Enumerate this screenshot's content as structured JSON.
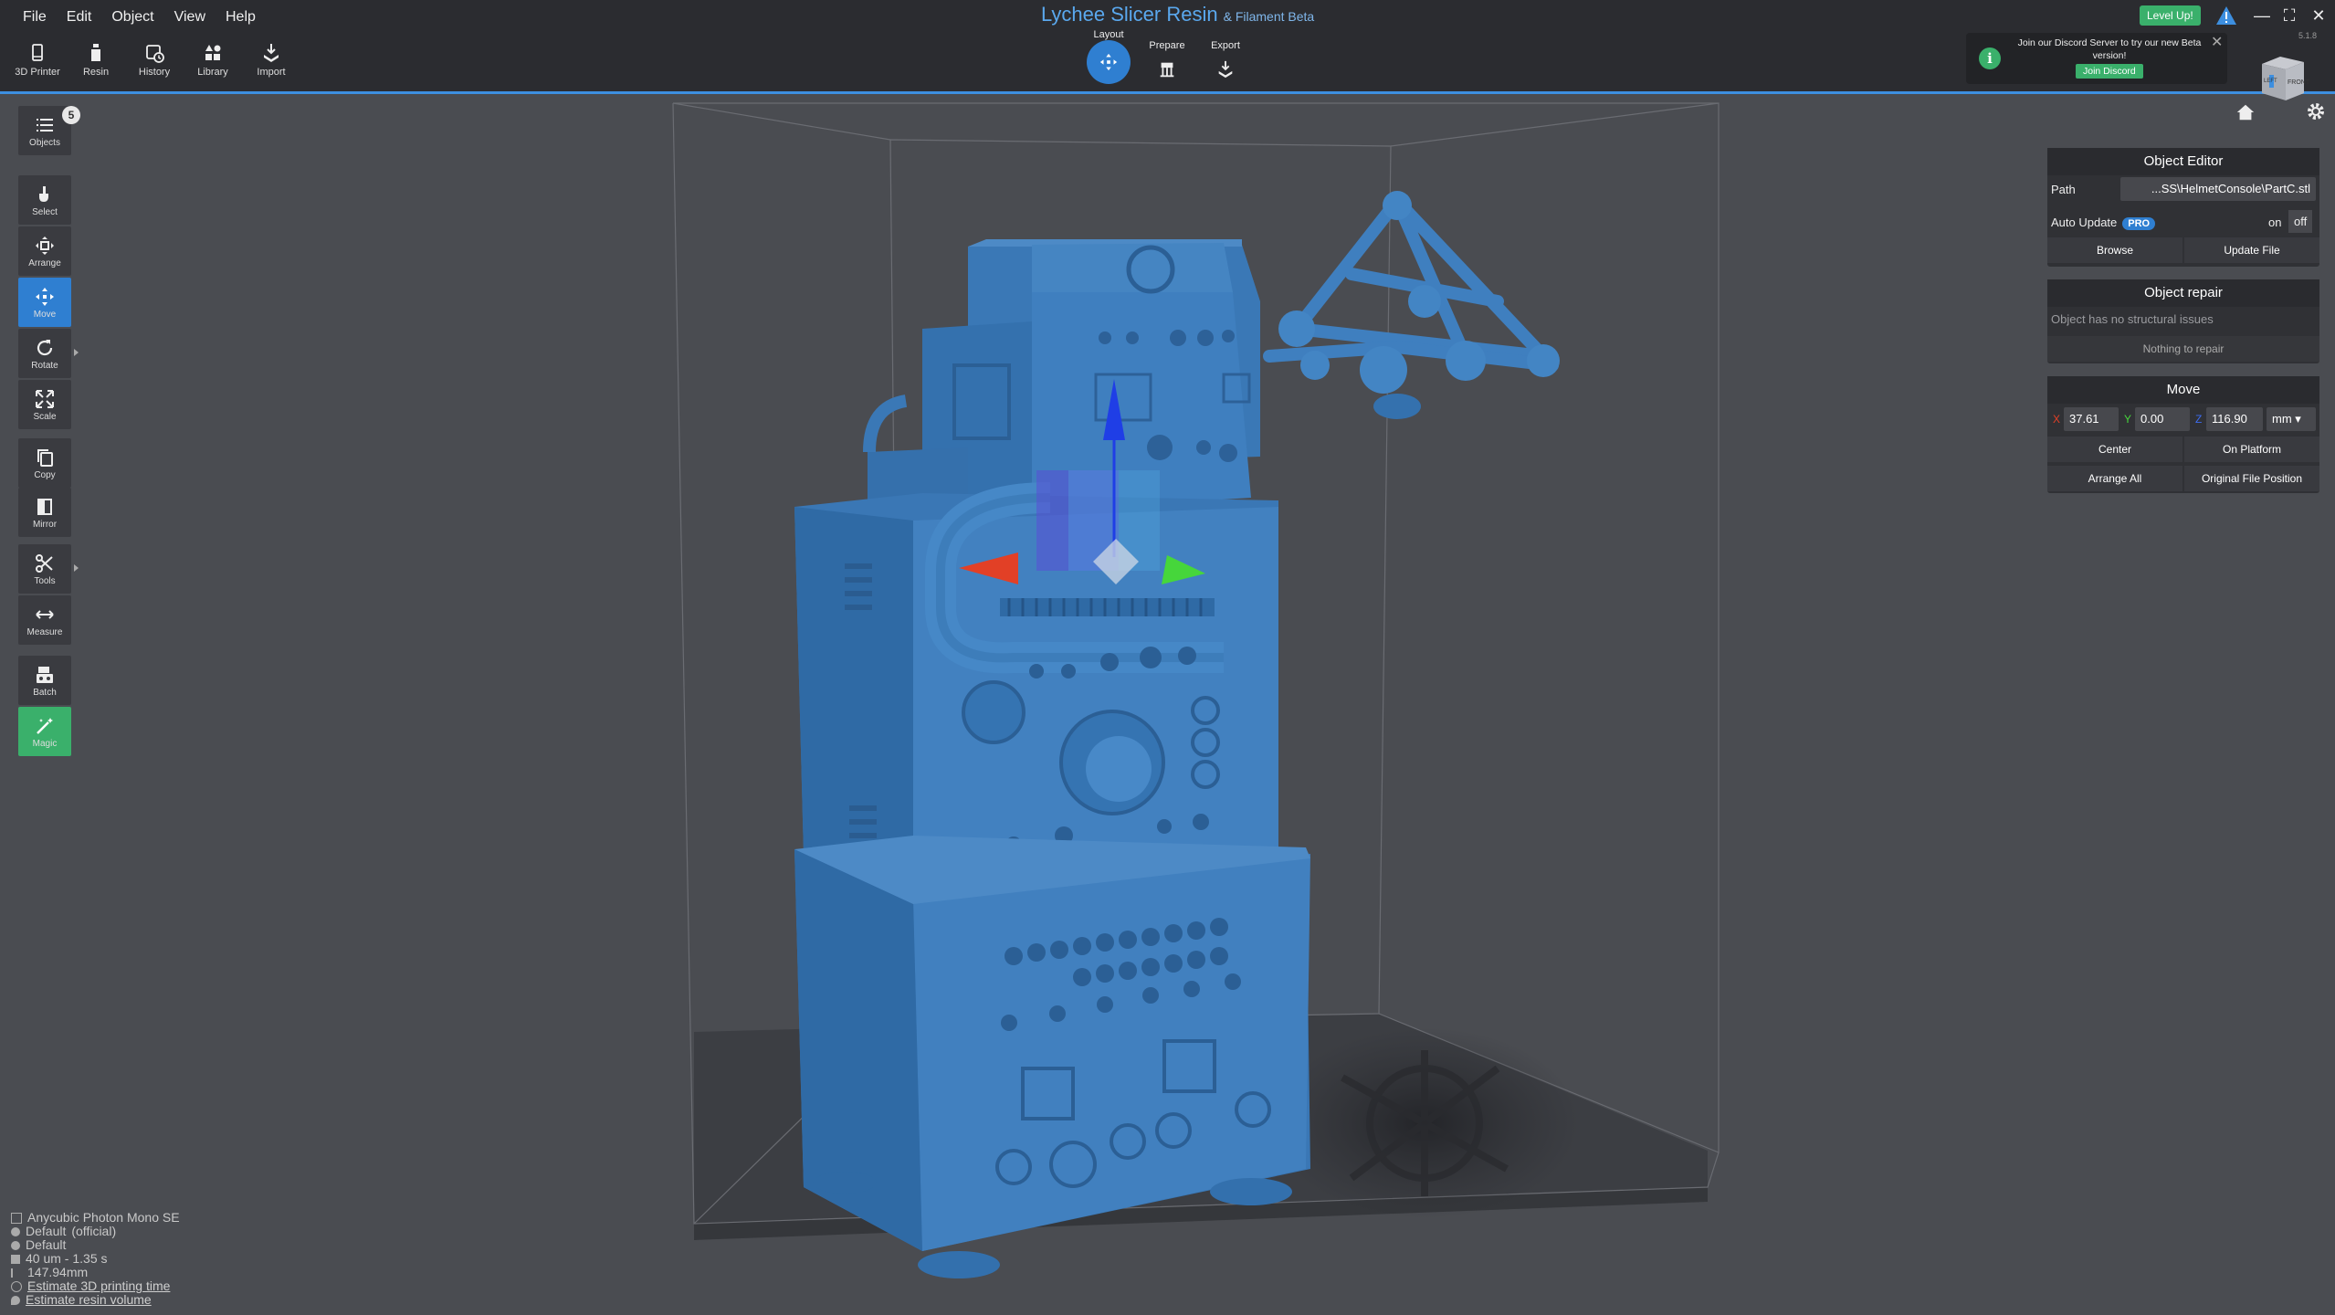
{
  "menu": [
    "File",
    "Edit",
    "Object",
    "View",
    "Help"
  ],
  "app_title": "Lychee Slicer Resin",
  "app_subtitle": "& Filament Beta",
  "version": "5.1.8",
  "toolbar": [
    {
      "label": "3D Printer",
      "icon": "printer-icon"
    },
    {
      "label": "Resin",
      "icon": "resin-bottle-icon"
    },
    {
      "label": "History",
      "icon": "history-icon"
    },
    {
      "label": "Library",
      "icon": "library-icon"
    },
    {
      "label": "Import",
      "icon": "import-icon"
    }
  ],
  "workflow": {
    "layout": "Layout",
    "prepare": "Prepare",
    "export": "Export",
    "active": "Layout"
  },
  "header_right": {
    "level_up": "Level Up!"
  },
  "discord_notice": {
    "message": "Join our Discord Server to try our new Beta version!",
    "button": "Join Discord",
    "info_glyph": "i"
  },
  "viewcube": {
    "face_front": "FRONT",
    "face_left": "LEFT"
  },
  "left_tools": [
    {
      "label": "Objects",
      "icon": "list-icon",
      "badge": "5"
    },
    {
      "label": "Select",
      "icon": "pointer-icon"
    },
    {
      "label": "Arrange",
      "icon": "arrange-icon"
    },
    {
      "label": "Move",
      "icon": "move-icon",
      "active": true
    },
    {
      "label": "Rotate",
      "icon": "rotate-icon",
      "submenu": true
    },
    {
      "label": "Scale",
      "icon": "scale-icon"
    },
    {
      "label": "Copy",
      "icon": "copy-icon"
    },
    {
      "label": "Mirror",
      "icon": "mirror-icon"
    },
    {
      "label": "Tools",
      "icon": "scissors-icon",
      "submenu": true
    },
    {
      "label": "Measure",
      "icon": "measure-icon"
    },
    {
      "label": "Batch",
      "icon": "batch-icon"
    },
    {
      "label": "Magic",
      "icon": "magic-wand-icon"
    }
  ],
  "object_editor": {
    "title": "Object Editor",
    "path_label": "Path",
    "path_value": "...SS\\HelmetConsole\\PartC.stl",
    "auto_update_label": "Auto Update",
    "pro_badge": "PRO",
    "toggle_on": "on",
    "toggle_off": "off",
    "browse": "Browse",
    "update_file": "Update File"
  },
  "object_repair": {
    "title": "Object repair",
    "status": "Object has no structural issues",
    "button": "Nothing to repair"
  },
  "move_panel": {
    "title": "Move",
    "x_label": "X",
    "x_value": "37.61",
    "y_label": "Y",
    "y_value": "0.00",
    "z_label": "Z",
    "z_value": "116.90",
    "unit": "mm",
    "center": "Center",
    "on_platform": "On Platform",
    "arrange_all": "Arrange All",
    "original_position": "Original File Position"
  },
  "printer_info": {
    "printer": "Anycubic Photon Mono SE",
    "resin": "Default",
    "resin_tag": "(official)",
    "profile": "Default",
    "layer": "40 um - 1.35 s",
    "height": "147.94mm",
    "estimate_time": "Estimate 3D printing time",
    "estimate_volume": "Estimate resin volume"
  },
  "colors": {
    "accent": "#2f7fd1",
    "green": "#3ab06b",
    "model": "#3f7fc0",
    "background": "#4a4c51"
  }
}
